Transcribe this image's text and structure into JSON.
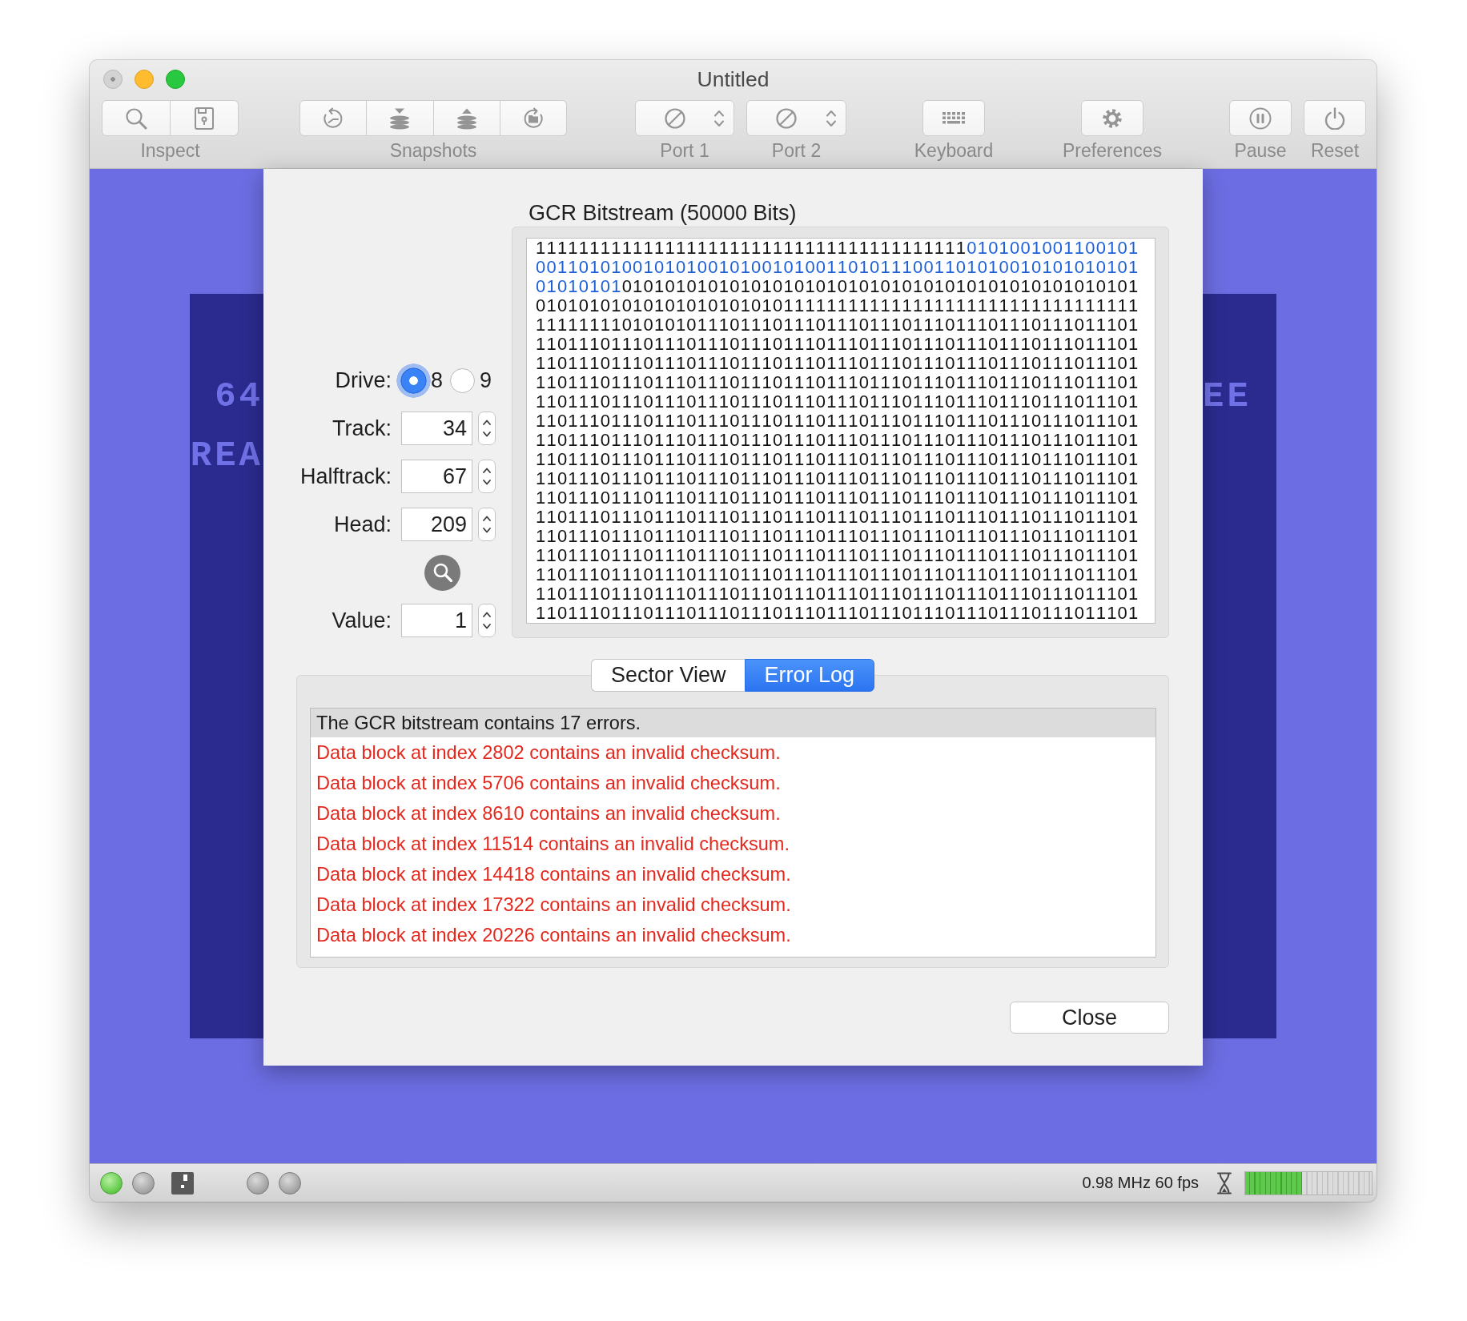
{
  "window": {
    "title": "Untitled",
    "close_enabled": false
  },
  "toolbar": [
    {
      "kind": "segmented",
      "label": "Inspect"
    },
    {
      "kind": "segmented",
      "label": "Snapshots"
    },
    {
      "kind": "popup",
      "label": "Port 1"
    },
    {
      "kind": "popup",
      "label": "Port 2"
    },
    {
      "kind": "button",
      "label": "Keyboard"
    },
    {
      "kind": "button",
      "label": "Preferences"
    },
    {
      "kind": "button",
      "label": "Pause"
    },
    {
      "kind": "button",
      "label": "Reset"
    }
  ],
  "screen": {
    "left_rows": [
      "64",
      "REA"
    ],
    "right_rows": [
      "EE"
    ]
  },
  "dialog": {
    "bitstream": {
      "title": "GCR Bitstream (50000 Bits)",
      "lines": [
        {
          "segments": [
            {
              "text": "1111111111111111111111111111111111111111",
              "highlighted": false
            },
            {
              "text": "0101001001100101",
              "highlighted": true
            }
          ]
        },
        {
          "segments": [
            {
              "text": "00110101001010100101001010011010111001101010010101010101",
              "highlighted": true
            }
          ]
        },
        {
          "segments": [
            {
              "text": "01010101",
              "highlighted": true
            },
            {
              "text": "010101010101010101010101010101010101010101010101",
              "highlighted": false
            }
          ]
        },
        {
          "segments": [
            {
              "text": "01010101010101010101010111111111111111111111111111111111",
              "highlighted": false
            }
          ]
        },
        {
          "segments": [
            {
              "text": "11111111010101011101110111011101110111011101110111011101",
              "highlighted": false
            }
          ]
        },
        {
          "segments": [
            {
              "text": "11011101110111011101110111011101110111011101110111011101",
              "highlighted": false
            }
          ]
        },
        {
          "segments": [
            {
              "text": "11011101110111011101110111011101110111011101110111011101",
              "highlighted": false
            }
          ]
        },
        {
          "segments": [
            {
              "text": "11011101110111011101110111011101110111011101110111011101",
              "highlighted": false
            }
          ]
        },
        {
          "segments": [
            {
              "text": "11011101110111011101110111011101110111011101110111011101",
              "highlighted": false
            }
          ]
        },
        {
          "segments": [
            {
              "text": "11011101110111011101110111011101110111011101110111011101",
              "highlighted": false
            }
          ]
        },
        {
          "segments": [
            {
              "text": "11011101110111011101110111011101110111011101110111011101",
              "highlighted": false
            }
          ]
        },
        {
          "segments": [
            {
              "text": "11011101110111011101110111011101110111011101110111011101",
              "highlighted": false
            }
          ]
        },
        {
          "segments": [
            {
              "text": "11011101110111011101110111011101110111011101110111011101",
              "highlighted": false
            }
          ]
        },
        {
          "segments": [
            {
              "text": "11011101110111011101110111011101110111011101110111011101",
              "highlighted": false
            }
          ]
        },
        {
          "segments": [
            {
              "text": "11011101110111011101110111011101110111011101110111011101",
              "highlighted": false
            }
          ]
        },
        {
          "segments": [
            {
              "text": "11011101110111011101110111011101110111011101110111011101",
              "highlighted": false
            }
          ]
        },
        {
          "segments": [
            {
              "text": "11011101110111011101110111011101110111011101110111011101",
              "highlighted": false
            }
          ]
        },
        {
          "segments": [
            {
              "text": "11011101110111011101110111011101110111011101110111011101",
              "highlighted": false
            }
          ]
        },
        {
          "segments": [
            {
              "text": "11011101110111011101110111011101110111011101110111011101",
              "highlighted": false
            }
          ]
        },
        {
          "segments": [
            {
              "text": "11011101110111011101110111011101110111011101110111011101",
              "highlighted": false
            }
          ]
        }
      ]
    },
    "drive": {
      "label": "Drive:",
      "options": [
        {
          "label": "8",
          "selected": true
        },
        {
          "label": "9",
          "selected": false
        }
      ]
    },
    "fields": [
      {
        "label": "Track:",
        "value": "34"
      },
      {
        "label": "Halftrack:",
        "value": "67"
      },
      {
        "label": "Head:",
        "value": "209"
      }
    ],
    "value_field": {
      "label": "Value:",
      "value": "1"
    },
    "tabs": [
      {
        "label": "Sector View",
        "selected": false
      },
      {
        "label": "Error Log",
        "selected": true
      }
    ],
    "log": {
      "rows": [
        {
          "kind": "summary",
          "text": "The GCR bitstream contains 17 errors."
        },
        {
          "kind": "error",
          "text": "Data block at index 2802 contains an invalid checksum."
        },
        {
          "kind": "error",
          "text": "Data block at index 5706 contains an invalid checksum."
        },
        {
          "kind": "error",
          "text": "Data block at index 8610 contains an invalid checksum."
        },
        {
          "kind": "error",
          "text": "Data block at index 11514 contains an invalid checksum."
        },
        {
          "kind": "error",
          "text": "Data block at index 14418 contains an invalid checksum."
        },
        {
          "kind": "error",
          "text": "Data block at index 17322 contains an invalid checksum."
        },
        {
          "kind": "error",
          "text": "Data block at index 20226 contains an invalid checksum."
        }
      ]
    },
    "close_button": {
      "label": "Close"
    }
  },
  "status_bar": {
    "drives": [
      {
        "power_led": true,
        "activity_led": false,
        "disk": true
      },
      {
        "power_led": false,
        "activity_led": false,
        "disk": false
      }
    ],
    "clock": "0.98 MHz 60 fps",
    "speed": {
      "level": 0.45
    }
  }
}
